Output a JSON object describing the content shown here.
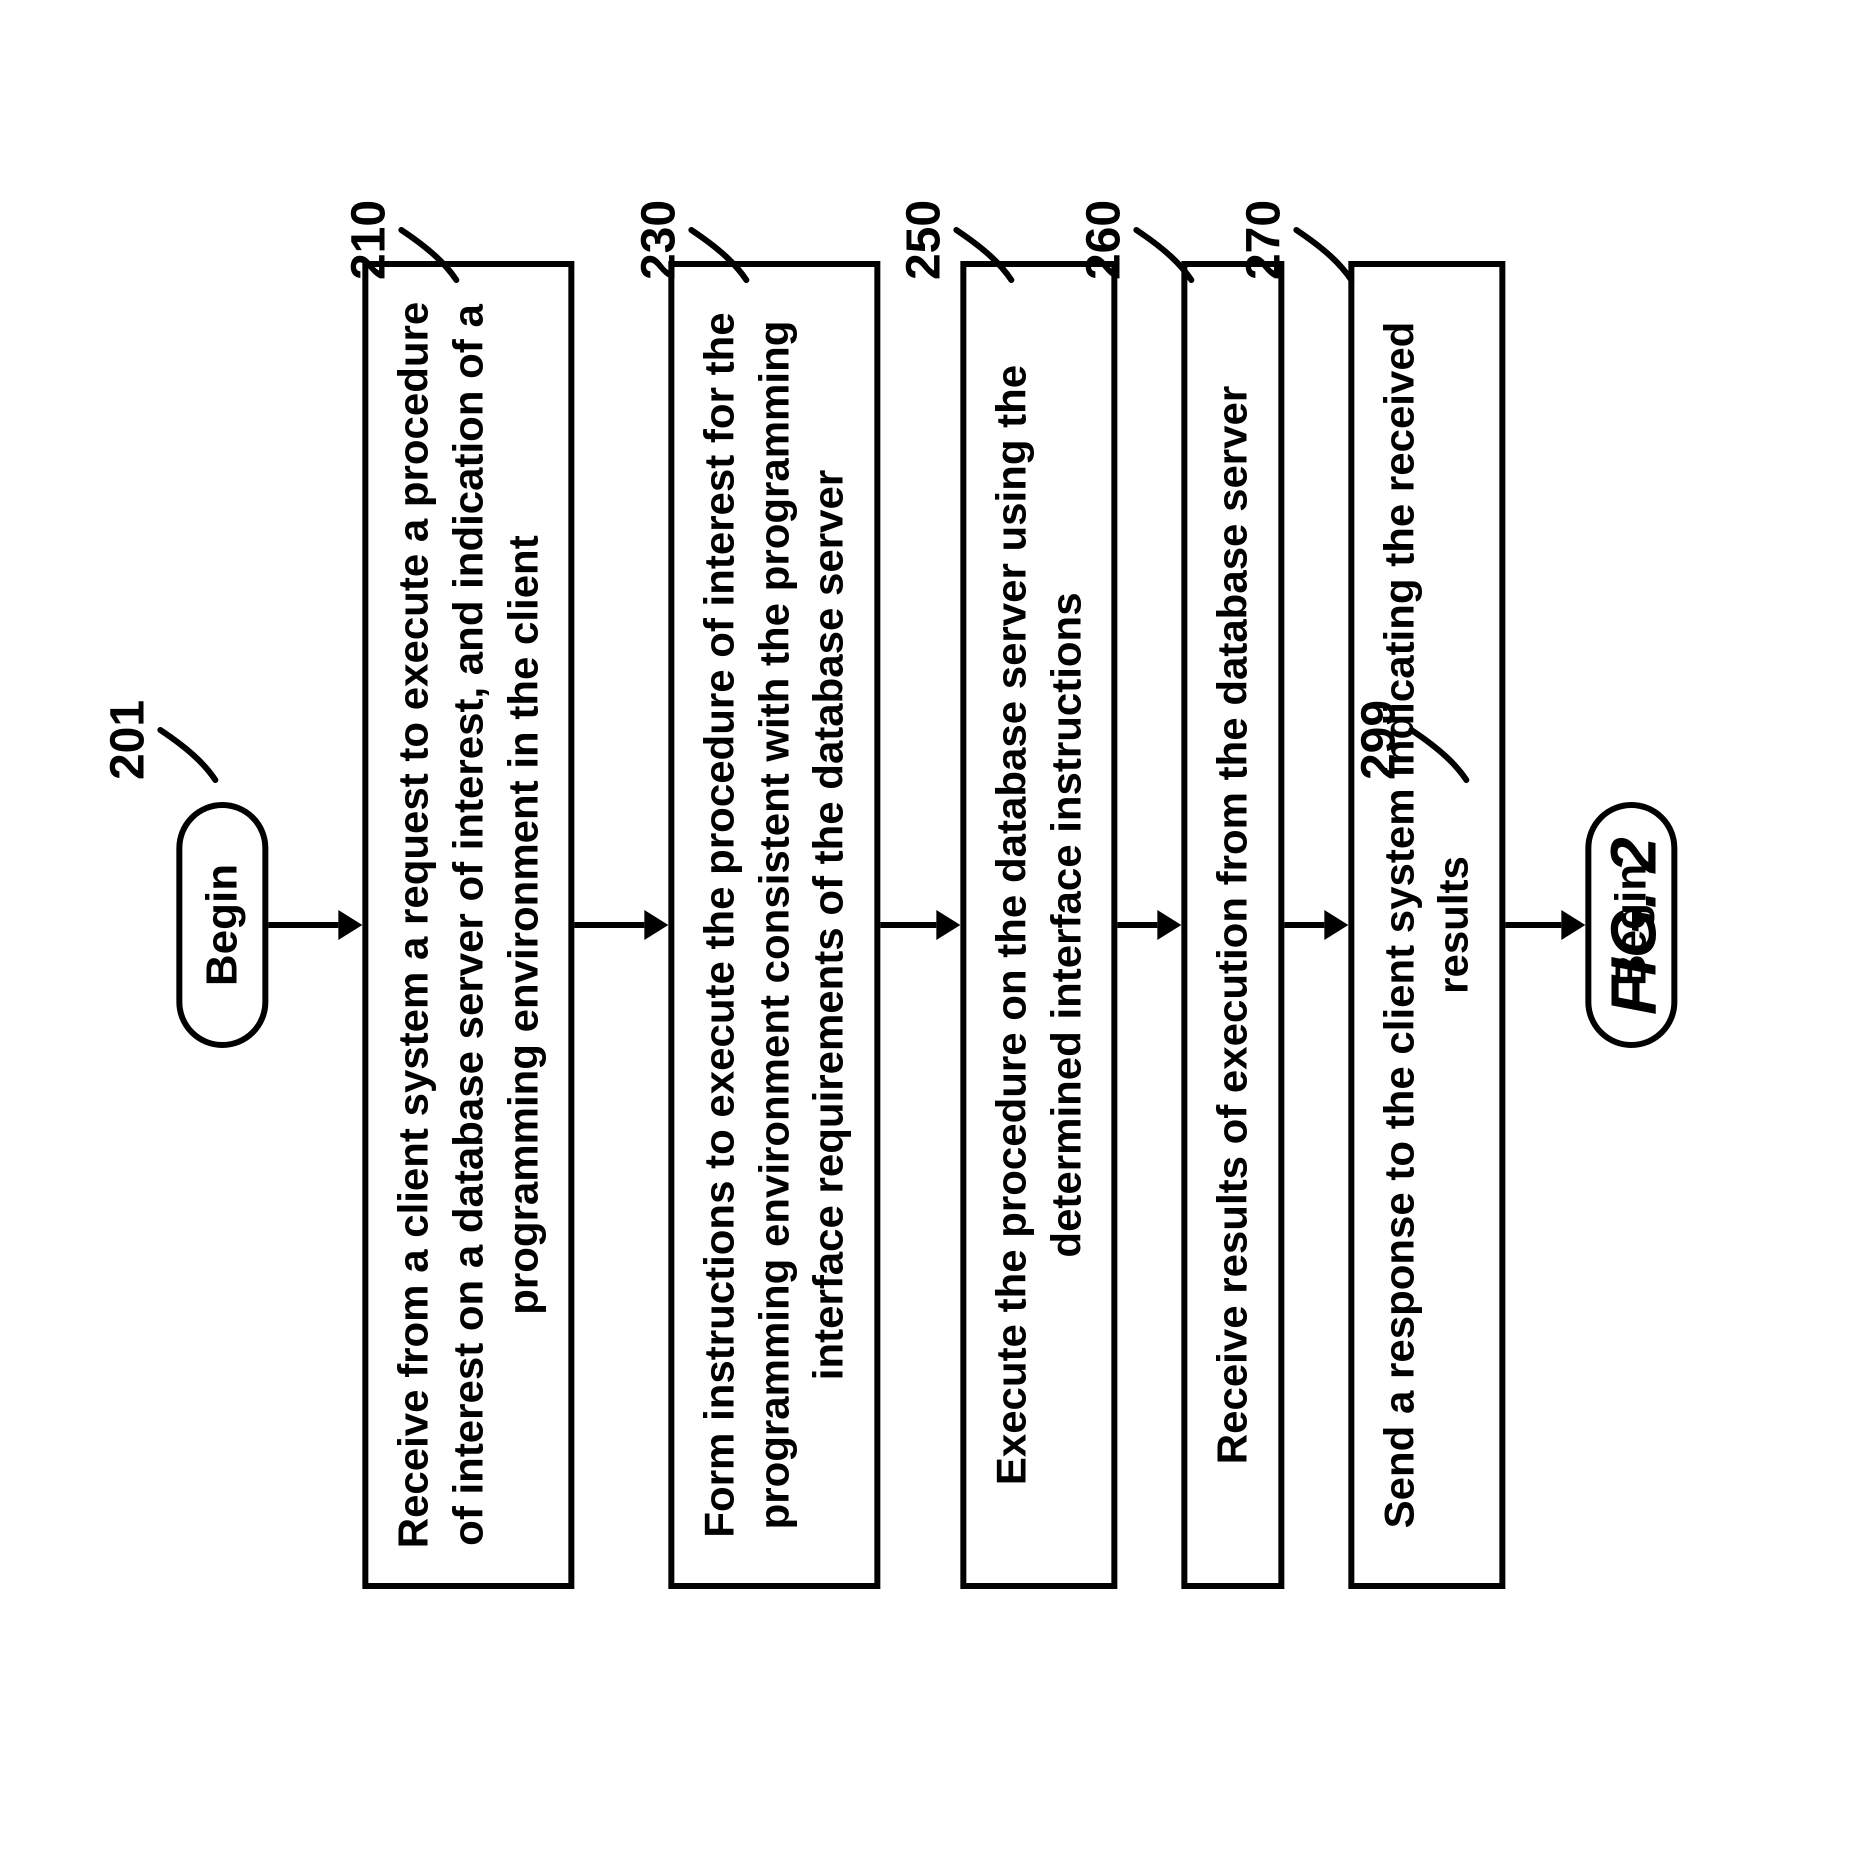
{
  "flow": {
    "begin": "Begin",
    "end": "Begin",
    "steps": {
      "s210": "Receive from a client system a request to execute a procedure of interest on a database server of interest, and indication of a programming environment in the client",
      "s230": "Form  instructions to execute the procedure of interest for the programming environment consistent with the programming interface requirements of the database server",
      "s250": "Execute the procedure on the database server using the determined interface instructions",
      "s260": "Receive results of execution from the database server",
      "s270": "Send a response to the client system indicating the received results"
    }
  },
  "labels": {
    "l201": "201",
    "l210": "210",
    "l230": "230",
    "l250": "250",
    "l260": "260",
    "l270": "270",
    "l299": "299"
  },
  "figure": "FIG. 2"
}
